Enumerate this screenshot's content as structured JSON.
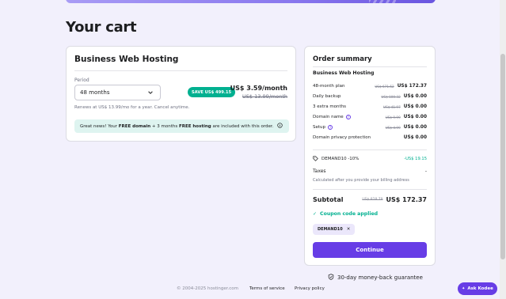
{
  "page_title": "Your cart",
  "product_card": {
    "title": "Business Web Hosting",
    "period_label": "Period",
    "period_value": "48 months",
    "save_badge": "SAVE US$ 499.15",
    "price_now": "US$ 3.59/month",
    "price_old": "US$ 13.99/month",
    "renew_note": "Renews at US$ 13.99/mo for a year. Cancel anytime.",
    "promo": {
      "part1": "Great news! Your ",
      "free_domain": "FREE domain",
      "part2": " + 3 months ",
      "free_hosting": "FREE hosting",
      "part3": " are included with this order."
    }
  },
  "summary": {
    "title": "Order summary",
    "product": "Business Web Hosting",
    "items": [
      {
        "label": "48-month plan",
        "old": "US$ 671.52",
        "value": "US$ 172.37"
      },
      {
        "label": "Daily backup",
        "old": "US$ 100.32",
        "value": "US$ 0.00"
      },
      {
        "label": "3 extra months",
        "old": "US$ 41.97",
        "value": "US$ 0.00"
      },
      {
        "label": "Domain name",
        "old": "US$ 9.99",
        "value": "US$ 0.00"
      },
      {
        "label": "Setup",
        "old": "US$ 4.99",
        "value": "US$ 0.00"
      },
      {
        "label": "Domain privacy protection",
        "old": "",
        "value": "US$ 0.00"
      }
    ],
    "coupon_label": "DEMAND10 -10%",
    "coupon_discount": "-US$ 19.15",
    "taxes_label": "Taxes",
    "taxes_value": "-",
    "taxes_note": "Calculated after you provide your billing address",
    "subtotal_label": "Subtotal",
    "subtotal_old": "US$ 828.79",
    "subtotal_value": "US$ 172.37",
    "coupon_applied": "Coupon code applied",
    "coupon_code": "DEMAND10",
    "continue_label": "Continue"
  },
  "guarantee": "30-day money-back guarantee",
  "footer": {
    "copyright": "© 2004-2025 hostinger.com",
    "terms": "Terms of service",
    "privacy": "Privacy policy"
  },
  "ask_button": "Ask Kodee",
  "colors": {
    "accent": "#673de6",
    "success": "#00b090",
    "background": "#f2f0fc"
  }
}
